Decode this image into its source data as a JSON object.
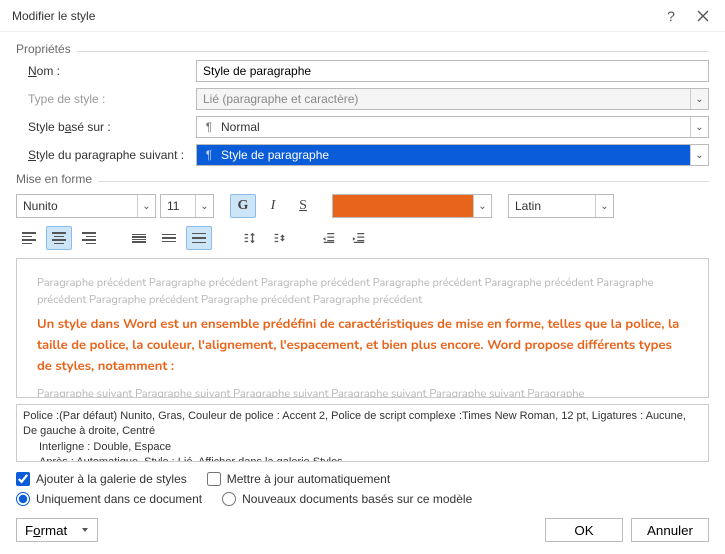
{
  "titlebar": {
    "title": "Modifier le style"
  },
  "sections": {
    "properties": "Propriétés",
    "formatting": "Mise en forme"
  },
  "props": {
    "name_label": "Nom :",
    "name_value": "Style de paragraphe",
    "type_label": "Type de style :",
    "type_value": "Lié (paragraphe et caractère)",
    "based_label": "Style basé sur :",
    "based_value": "Normal",
    "next_label": "Style du paragraphe suivant :",
    "next_value": "Style de paragraphe"
  },
  "fmt": {
    "font": "Nunito",
    "size": "11",
    "bold": "G",
    "italic": "I",
    "underline": "S",
    "color": "#e8641b",
    "script": "Latin"
  },
  "preview": {
    "before": "Paragraphe précédent Paragraphe précédent Paragraphe précédent Paragraphe précédent Paragraphe précédent Paragraphe précédent Paragraphe précédent Paragraphe précédent Paragraphe précédent",
    "main": "Un style dans Word est un ensemble prédéfini de caractéristiques de mise en forme, telles que la police, la taille de police, la couleur, l'alignement, l'espacement, et bien plus encore. Word propose différents types de styles, notamment :",
    "after": "Paragraphe suivant Paragraphe suivant Paragraphe suivant Paragraphe suivant Paragraphe suivant Paragraphe"
  },
  "desc": {
    "line1": "Police :(Par défaut) Nunito, Gras, Couleur de police : Accent 2, Police de script complexe :Times New Roman, 12 pt, Ligatures : Aucune, De gauche à droite, Centré",
    "line2": "Interligne : Double, Espace",
    "line3": "Après : Automatique, Style : Lié, Afficher dans la galerie Styles"
  },
  "options": {
    "add_gallery": "Ajouter à la galerie de styles",
    "auto_update": "Mettre à jour automatiquement",
    "only_doc": "Uniquement dans ce document",
    "new_docs": "Nouveaux documents basés sur ce modèle"
  },
  "footer": {
    "format": "Format",
    "ok": "OK",
    "cancel": "Annuler"
  }
}
